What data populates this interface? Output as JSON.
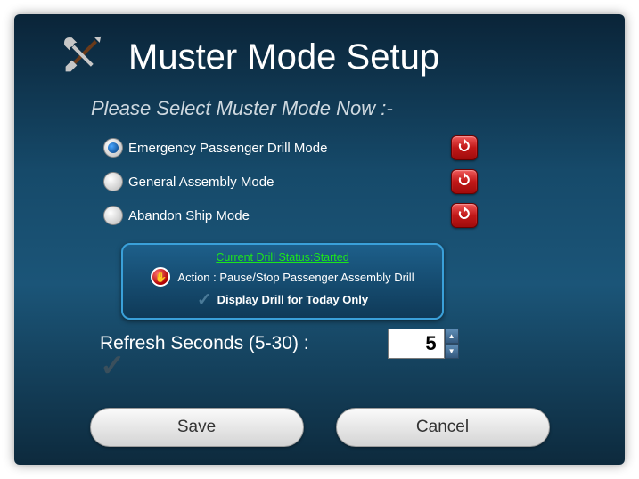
{
  "title": "Muster Mode Setup",
  "subtitle": "Please Select Muster Mode Now :-",
  "options": [
    {
      "label": "Emergency Passenger Drill Mode",
      "selected": true
    },
    {
      "label": "General Assembly Mode",
      "selected": false
    },
    {
      "label": "Abandon Ship Mode",
      "selected": false
    }
  ],
  "status": {
    "link_text": "Current Drill Status:Started",
    "action_text": "Action : Pause/Stop Passenger Assembly Drill",
    "display_text": "Display Drill for Today Only"
  },
  "refresh": {
    "label": "Refresh Seconds (5-30) :",
    "value": "5"
  },
  "buttons": {
    "save": "Save",
    "cancel": "Cancel"
  }
}
